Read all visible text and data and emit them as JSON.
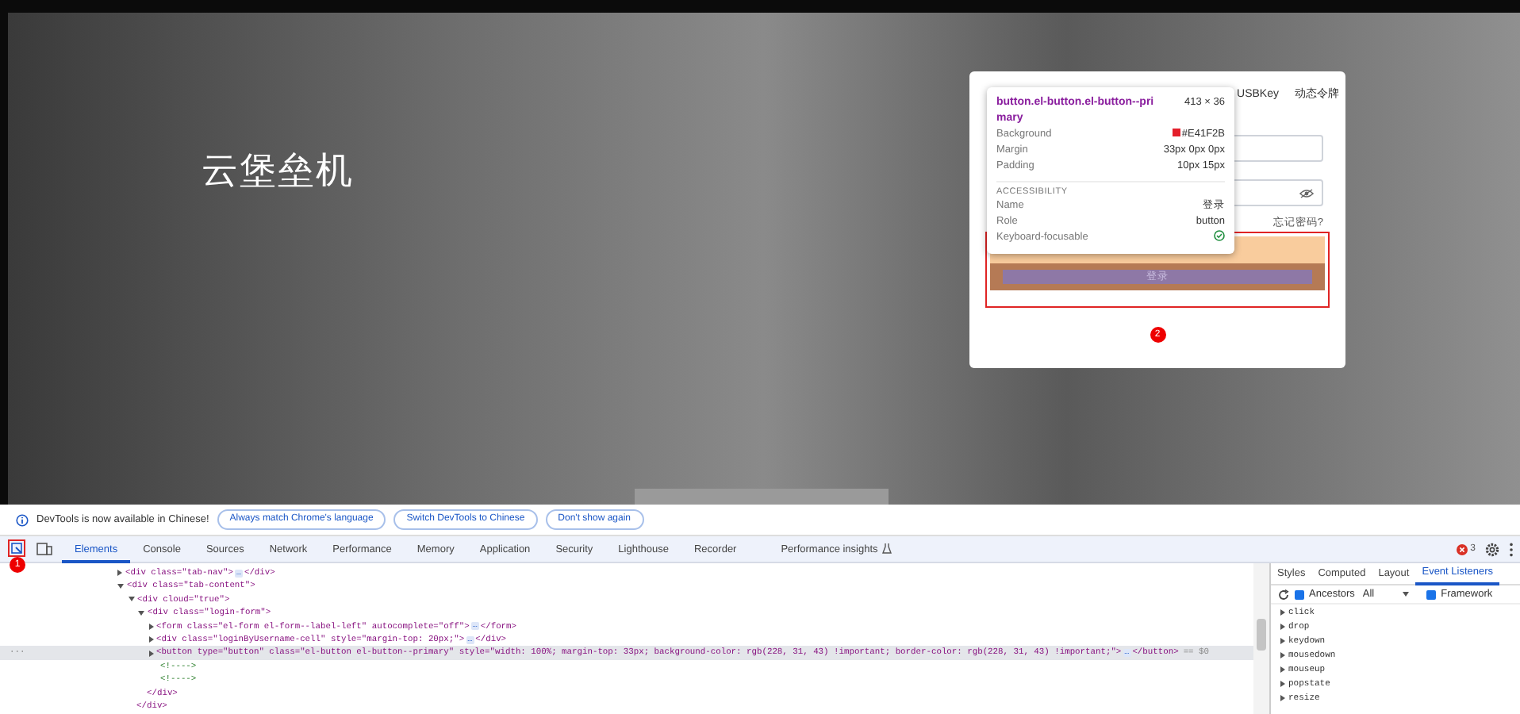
{
  "page": {
    "title": "云堡垒机",
    "login": {
      "tabs": [
        {
          "label": "USBKey",
          "selected": false
        },
        {
          "label": "动态令牌",
          "selected": false
        }
      ],
      "forgot_link": "忘记密码?",
      "button_label": "登录"
    },
    "tooltip": {
      "selector": "button.el-button.el-button--primary",
      "size": "413 × 36",
      "rows": [
        {
          "label": "Background",
          "value": "#E41F2B",
          "kind": "color"
        },
        {
          "label": "Margin",
          "value": "33px 0px 0px",
          "kind": "text"
        },
        {
          "label": "Padding",
          "value": "10px 15px",
          "kind": "text"
        }
      ],
      "section": "ACCESSIBILITY",
      "a11y": [
        {
          "label": "Name",
          "value": "登录",
          "kind": "text"
        },
        {
          "label": "Role",
          "value": "button",
          "kind": "text"
        },
        {
          "label": "Keyboard-focusable",
          "kind": "check"
        }
      ]
    },
    "highlight_badge": "2"
  },
  "devtools": {
    "notice": {
      "text": "DevTools is now available in Chinese!",
      "buttons": [
        "Always match Chrome's language",
        "Switch DevTools to Chinese",
        "Don't show again"
      ]
    },
    "inspect_badge": "1",
    "tabs": [
      {
        "label": "Elements",
        "selected": true
      },
      {
        "label": "Console",
        "selected": false
      },
      {
        "label": "Sources",
        "selected": false
      },
      {
        "label": "Network",
        "selected": false
      },
      {
        "label": "Performance",
        "selected": false
      },
      {
        "label": "Memory",
        "selected": false
      },
      {
        "label": "Application",
        "selected": false
      },
      {
        "label": "Security",
        "selected": false
      },
      {
        "label": "Lighthouse",
        "selected": false
      },
      {
        "label": "Recorder",
        "selected": false
      },
      {
        "label": "Performance insights",
        "selected": false
      }
    ],
    "error_count": "3",
    "dom": [
      {
        "kind": "element",
        "open": "<div class=\"tab-nav\">",
        "expanded": false,
        "ellipsis": "…",
        "close": "</div>",
        "selected": false
      },
      {
        "kind": "element",
        "open": "<div class=\"tab-content\">",
        "expanded": true,
        "selected": false,
        "children": [
          {
            "kind": "element",
            "open": "<div cloud=\"true\">",
            "expanded": true,
            "selected": false,
            "close": "</div>",
            "children": [
              {
                "kind": "element",
                "open": "<div class=\"login-form\">",
                "expanded": true,
                "selected": false,
                "close": "</div>",
                "children": [
                  {
                    "kind": "element",
                    "open": "<form class=\"el-form el-form--label-left\" autocomplete=\"off\">",
                    "expanded": false,
                    "ellipsis": "…",
                    "close": "</form>",
                    "selected": false
                  },
                  {
                    "kind": "element",
                    "open": "<div class=\"loginByUsername-cell\" style=\"margin-top: 20px;\">",
                    "expanded": false,
                    "ellipsis": "…",
                    "close": "</div>",
                    "selected": false
                  },
                  {
                    "kind": "element",
                    "open": "<button type=\"button\" class=\"el-button el-button--primary\" style=\"width: 100%; margin-top: 33px; background-color: rgb(228, 31, 43) !important; border-color: rgb(228, 31, 43) !important;\">",
                    "expanded": false,
                    "ellipsis": "…",
                    "close": "</button>",
                    "suffix": "== $0",
                    "selected": true
                  },
                  {
                    "kind": "comment",
                    "open": "<!---->",
                    "selected": false
                  },
                  {
                    "kind": "comment",
                    "open": "<!---->",
                    "selected": false
                  }
                ]
              }
            ]
          }
        ]
      }
    ],
    "row_menu": "···",
    "sidebar_tabs": [
      {
        "label": "Styles",
        "selected": false
      },
      {
        "label": "Computed",
        "selected": false
      },
      {
        "label": "Layout",
        "selected": false
      },
      {
        "label": "Event Listeners",
        "selected": true
      }
    ],
    "filters": [
      {
        "kind": "refresh"
      },
      {
        "kind": "checkbox",
        "label": "Ancestors",
        "checked": true
      },
      {
        "kind": "select",
        "label": "All"
      },
      {
        "kind": "checkbox",
        "label": "Framework",
        "checked": true
      }
    ],
    "events": [
      "click",
      "drop",
      "keydown",
      "mousedown",
      "mouseup",
      "popstate",
      "resize"
    ]
  }
}
